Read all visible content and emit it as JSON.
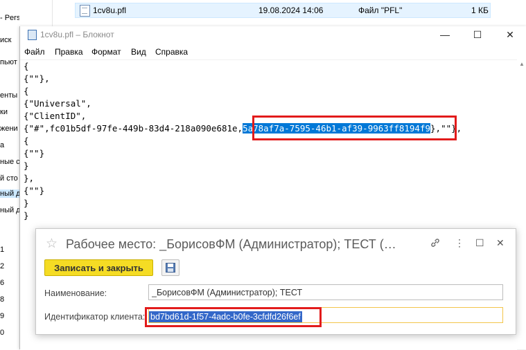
{
  "explorer": {
    "sidebar_items": [
      "- Personal",
      "иск",
      "пьют",
      "енты",
      "ки",
      "жени",
      "а",
      "ные с",
      "й сто",
      "ный д",
      "ный д"
    ],
    "sidebar_numbers": [
      "1",
      "2",
      "6",
      "8",
      "9",
      "0"
    ],
    "file": {
      "name": "1cv8u.pfl",
      "modified": "19.08.2024 14:06",
      "type": "Файл \"PFL\"",
      "size": "1 КБ"
    }
  },
  "notepad": {
    "title": "1cv8u.pfl – Блокнот",
    "window_controls": {
      "minimize": "—",
      "maximize": "☐",
      "close": "✕"
    },
    "menu": [
      "Файл",
      "Правка",
      "Формат",
      "Вид",
      "Справка"
    ],
    "lines": [
      "{",
      "{\"\"},",
      "{",
      "{\"Universal\",",
      "{\"ClientID\",",
      "{\"#\",fc01b5df-97fe-449b-83d4-218a090e681e,",
      "{",
      "{\"\"}",
      "}",
      "},",
      "{\"\"}",
      "}",
      "}"
    ],
    "selected_text": "5a78af7a-7595-46b1-af39-9963ff8194f9",
    "line_suffix": "},\"\"},"
  },
  "dialog": {
    "title": "Рабочее место: _БорисовФМ (Администратор); ТЕСТ (…",
    "save_close_label": "Записать и закрыть",
    "icons": {
      "star": "☆",
      "link": "🔗",
      "more": "⋮",
      "maximize": "☐",
      "close": "✕"
    },
    "name_label": "Наименование:",
    "name_value": "_БорисовФМ (Администратор); ТЕСТ",
    "client_id_label": "Идентификатор клиента:",
    "client_id_value": "bd7bd61d-1f57-4adc-b0fe-3cfdfd26f6ef"
  },
  "colors": {
    "highlight_box": "#e21b1b",
    "selection": "#0078d7",
    "button_yellow": "#f5dc24"
  }
}
